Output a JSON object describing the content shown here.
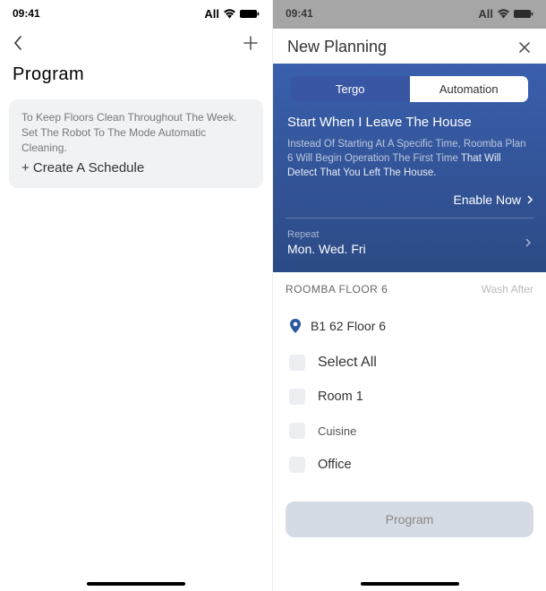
{
  "statusbar": {
    "time": "09:41",
    "carrier": "All"
  },
  "left": {
    "title": "Program",
    "card_text": "To Keep Floors Clean Throughout The Week. Set The Robot To The Mode Automatic Cleaning.",
    "card_action": "+ Create A Schedule"
  },
  "right": {
    "modal_title": "New Planning",
    "tabs": {
      "active": "Tergo",
      "inactive": "Automation"
    },
    "hero": {
      "title": "Start When I Leave The House",
      "desc1": "Instead Of Starting At A Specific Time, Roomba Plan 6 Will Begin Operation The First Time",
      "desc2": "That Will Detect That You Left The House.",
      "enable": "Enable Now"
    },
    "repeat": {
      "label": "Repeat",
      "value": "Mon. Wed. Fri"
    },
    "list_header": {
      "left": "ROOMBA FLOOR 6",
      "right": "Wash After"
    },
    "location": "B1 62 Floor 6",
    "select_all": "Select All",
    "rooms": [
      "Room 1",
      "Cuisine",
      "Office"
    ],
    "program_btn": "Program"
  }
}
